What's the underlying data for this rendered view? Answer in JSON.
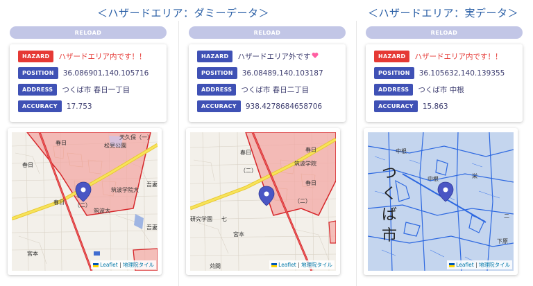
{
  "titles": [
    "＜ハザードエリア：ダミーデータ＞",
    "＜ハザードエリア：実データ＞"
  ],
  "reload_label": "RELOAD",
  "tags": {
    "hazard": "HAZARD",
    "position": "POSITION",
    "address": "ADDRESS",
    "accuracy": "ACCURACY"
  },
  "panels": [
    {
      "hazard": "ハザードエリア内です！！",
      "position": "36.086901,140.105716",
      "address": "つくば市 春日一丁目",
      "accuracy": "17.753"
    },
    {
      "hazard": "ハザードエリア外です",
      "position": "36.08489,140.103187",
      "address": "つくば市 春日二丁目",
      "accuracy": "938.4278684658706"
    },
    {
      "hazard": "ハザードエリア内です！！",
      "position": "36.105632,140.139355",
      "address": "つくば市 中根",
      "accuracy": "15.863"
    }
  ],
  "attribution": {
    "leaflet": "Leaflet",
    "sep": " | ",
    "tiles": "地理院タイル"
  },
  "map_labels": {
    "m1": [
      "天久保（一）",
      "春日",
      "松見公園",
      "春日",
      "筑波学院大",
      "春日",
      "（二）",
      "筑波大",
      "吾妻",
      "吾妻",
      "宮本",
      "春日"
    ],
    "m2": [
      "春日",
      "（二）",
      "筑波学院",
      "春日",
      "（二）",
      "研究学園",
      "七",
      "宮本",
      "苅間",
      "春日"
    ],
    "m3": [
      "中根",
      "つ",
      "く",
      "ば",
      "市",
      "中根",
      "栄",
      "下原",
      "二"
    ]
  },
  "colors": {
    "accent": "#3f51b5",
    "danger": "#e53935",
    "title": "#2a5fa6",
    "reload": "#c2c6e6"
  }
}
